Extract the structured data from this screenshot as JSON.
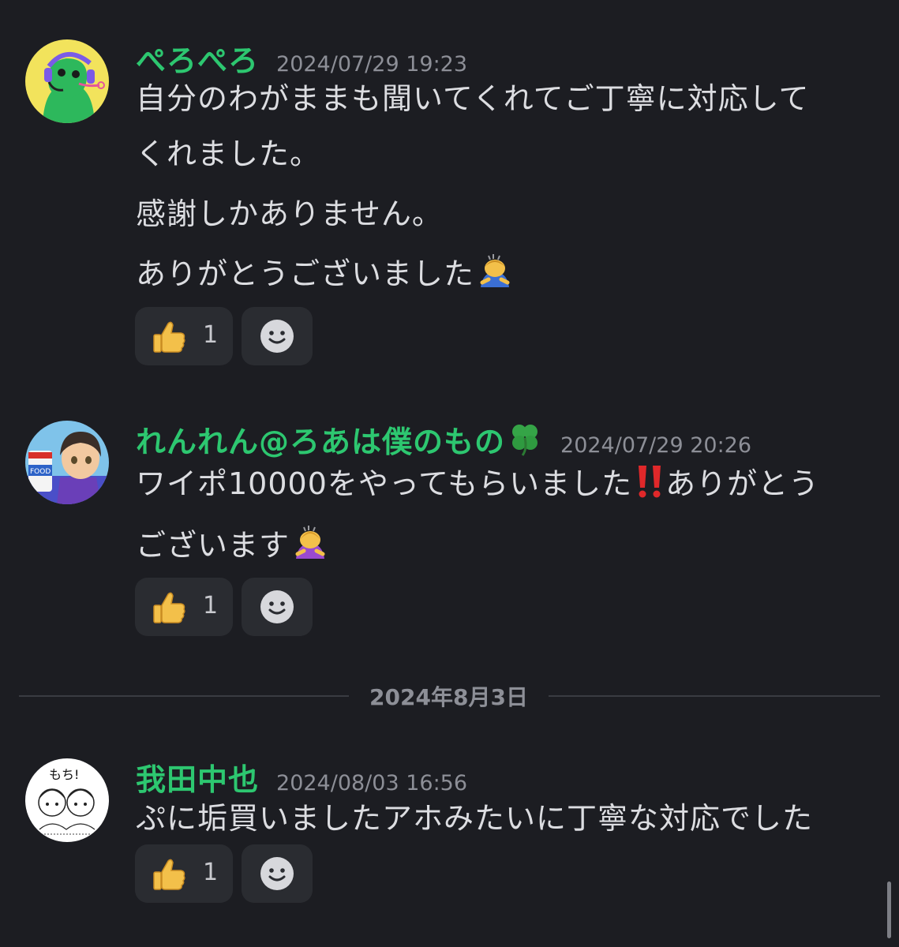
{
  "messages": [
    {
      "username": "ぺろぺろ",
      "timestamp": "2024/07/29 19:23",
      "lines": [
        "自分のわがままも聞いてくれてご丁寧に対応して",
        "くれました。",
        "感謝しかありません。",
        "ありがとうございました"
      ],
      "reaction_count": "1"
    },
    {
      "username": "れんれん@ろあは僕のもの",
      "timestamp": "2024/07/29 20:26",
      "lines": [
        "ワイポ10000をやってもらいました",
        "ありがとう",
        "ございます"
      ],
      "reaction_count": "1"
    },
    {
      "username": "我田中也",
      "timestamp": "2024/08/03 16:56",
      "lines": [
        "ぷに垢買いましたアホみたいに丁寧な対応でした"
      ],
      "reaction_count": "1"
    }
  ],
  "date_divider": "2024年8月3日",
  "avatar3_text": "もち!",
  "icons": {
    "reaction_emoji": "thumbs-up-icon",
    "add_reaction": "add-reaction-smile-icon",
    "bow_emoji": "person-bowing-icon",
    "clover_emoji": "four-leaf-clover-icon",
    "exclamation_emoji": "double-exclamation-icon"
  },
  "colors": {
    "background": "#1c1d22",
    "username": "#2dc770",
    "timestamp": "#8d8f97",
    "text": "#dcdde1",
    "reaction_bg": "#2a2c31"
  }
}
